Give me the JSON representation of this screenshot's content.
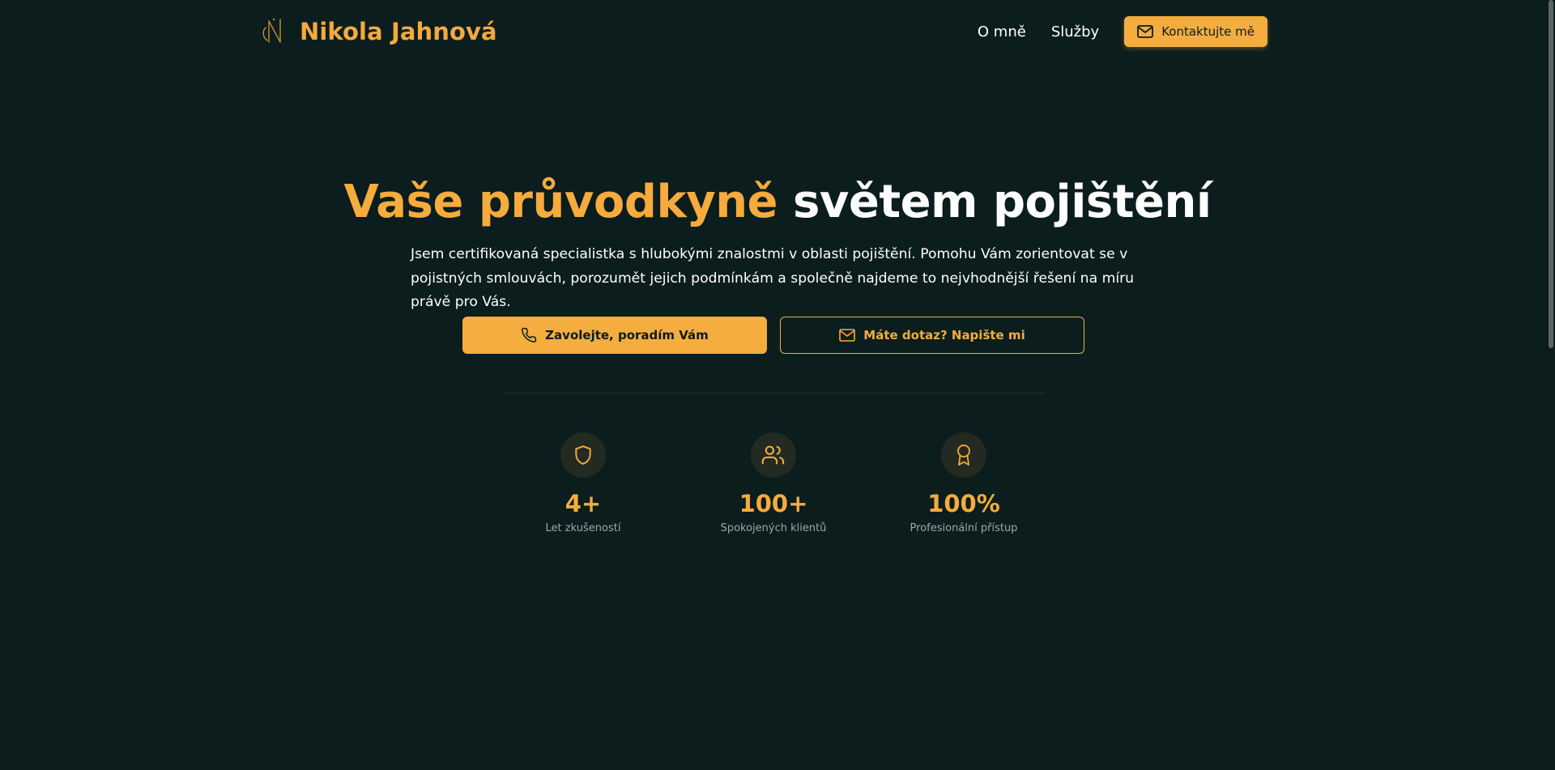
{
  "header": {
    "brand_name": "Nikola Jahnová",
    "nav": [
      {
        "label": "O mně"
      },
      {
        "label": "Služby"
      }
    ],
    "contact_button": "Kontaktujte mě"
  },
  "hero": {
    "title_accent": "Vaše průvodkyně",
    "title_rest": "světem pojištění",
    "description": "Jsem certifikovaná specialistka s hlubokými znalostmi v oblasti pojištění. Pomohu Vám zorientovat se v pojistných smlouvách, porozumět jejich podmínkám a společně najdeme to nejvhodnější řešení na míru právě pro Vás.",
    "primary_cta": "Zavolejte, poradím Vám",
    "secondary_cta": "Máte dotaz? Napište mi"
  },
  "stats": [
    {
      "value": "4+",
      "label": "Let zkušeností",
      "icon": "shield-icon"
    },
    {
      "value": "100+",
      "label": "Spokojených klientů",
      "icon": "users-icon"
    },
    {
      "value": "100%",
      "label": "Profesionální přístup",
      "icon": "award-icon"
    }
  ],
  "colors": {
    "background": "#0b1d1d",
    "accent": "#f5ad40",
    "text": "#ffffff",
    "muted": "#9ca8a8"
  }
}
